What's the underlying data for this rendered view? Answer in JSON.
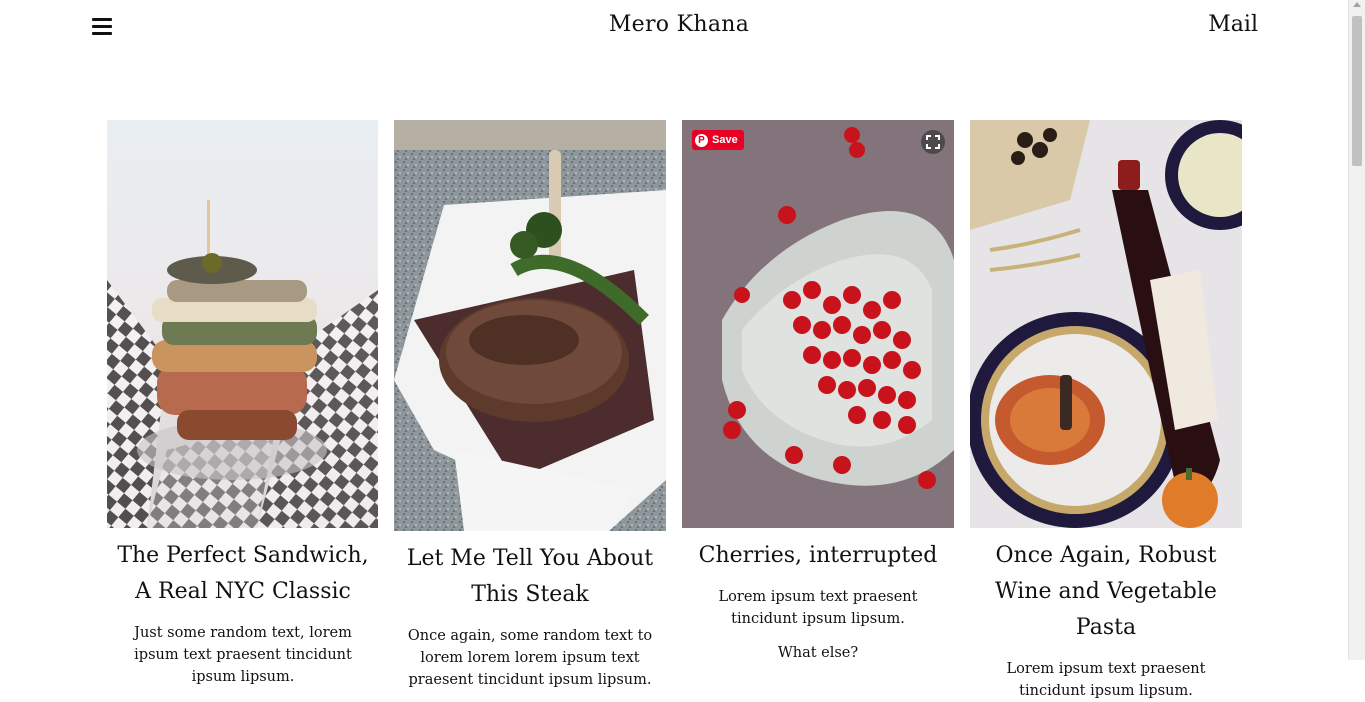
{
  "header": {
    "title": "Mero Khana",
    "mail_label": "Mail"
  },
  "pin": {
    "save_label": "Save"
  },
  "cards": [
    {
      "title": "The Perfect Sandwich, A Real NYC Classic",
      "text": "Just some random text, lorem ipsum text praesent tincidunt ipsum lipsum."
    },
    {
      "title": "Let Me Tell You About This Steak",
      "text": "Once again, some random text to lorem lorem lorem ipsum text praesent tincidunt ipsum lipsum."
    },
    {
      "title": "Cherries, interrupted",
      "text": "Lorem ipsum text praesent tincidunt ipsum lipsum.",
      "text2": "What else?"
    },
    {
      "title": "Once Again, Robust Wine and Vegetable Pasta",
      "text": "Lorem ipsum text praesent tincidunt ipsum lipsum."
    }
  ]
}
